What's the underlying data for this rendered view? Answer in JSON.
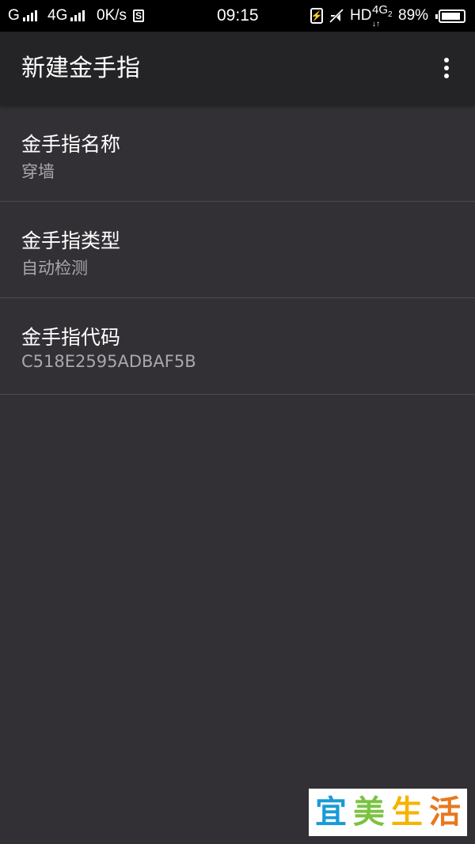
{
  "status_bar": {
    "network_1": "G",
    "network_2": "4G",
    "speed": "0K/s",
    "sim_badge": "S",
    "time": "09:15",
    "hd_label": "HD",
    "network_3": "4G",
    "network_3_sub": "2",
    "battery_percent": "89%",
    "battery_level": 0.89
  },
  "app_bar": {
    "title": "新建金手指",
    "overflow_icon": "more-vert-icon"
  },
  "preferences": [
    {
      "title": "金手指名称",
      "summary": "穿墙"
    },
    {
      "title": "金手指类型",
      "summary": "自动检测"
    },
    {
      "title": "金手指代码",
      "summary": "C518E2595ADBAF5B"
    }
  ],
  "watermark": {
    "chars": [
      "宜",
      "美",
      "生",
      "活"
    ],
    "colors": [
      "#1a9ad6",
      "#7cc242",
      "#f5b400",
      "#e8781e"
    ]
  }
}
